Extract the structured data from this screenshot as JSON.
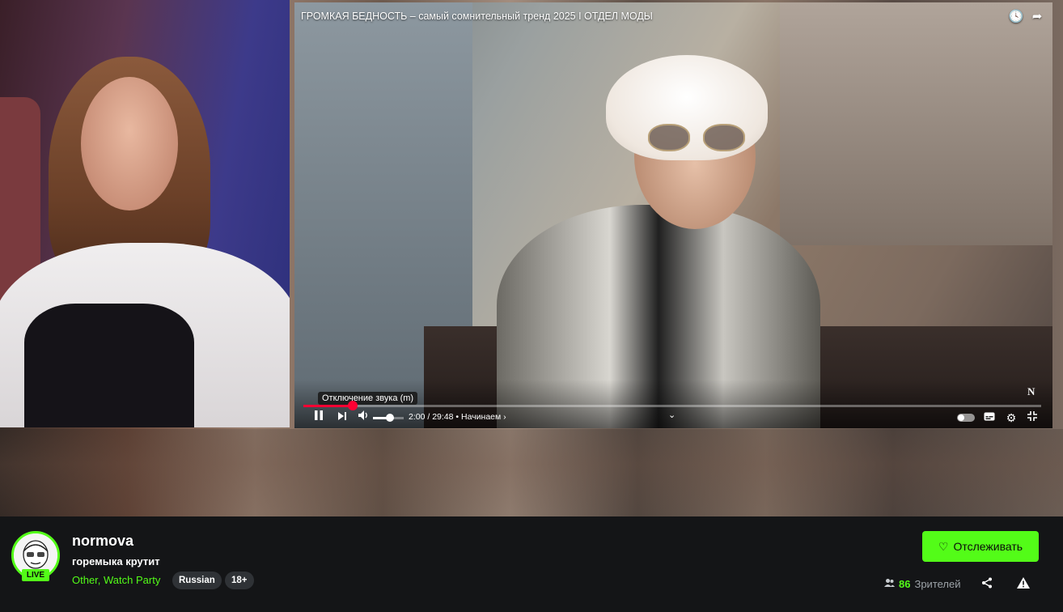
{
  "player": {
    "video_title": "ГРОМКАЯ БЕДНОСТЬ – самый сомнительный тренд 2025 I ОТДЕЛ МОДЫ",
    "watch_later_icon": "clock-icon",
    "share_icon": "share-arrow-icon",
    "progress_fraction": 0.067,
    "volume_fraction": 0.55,
    "mute_tooltip": "Отключение звука (m)",
    "time_current": "2:00",
    "time_separator": " / ",
    "time_total": "29:48",
    "chapter_separator": " • ",
    "chapter": "Начинаем",
    "chapter_arrow": "›",
    "center_chevron": "⌄",
    "watermark": "N",
    "icons": {
      "pause": "pause-icon",
      "next": "next-icon",
      "volume": "volume-icon",
      "autoplay": "autoplay-toggle",
      "subtitles": "subtitles-icon",
      "settings": "gear-icon",
      "exit_fullscreen": "exit-fullscreen-icon"
    }
  },
  "channel": {
    "name": "normova",
    "live_label": "LIVE",
    "stream_title": "горемыка крутит",
    "category": "Other, Watch Party",
    "tags": [
      "Russian",
      "18+"
    ],
    "follow_label": "Отслеживать",
    "viewer_count": "86",
    "viewer_label": "Зрителей"
  },
  "colors": {
    "accent": "#53fc18",
    "background": "#141517",
    "tag_bg": "#2f3236",
    "progress": "#ff0033"
  }
}
